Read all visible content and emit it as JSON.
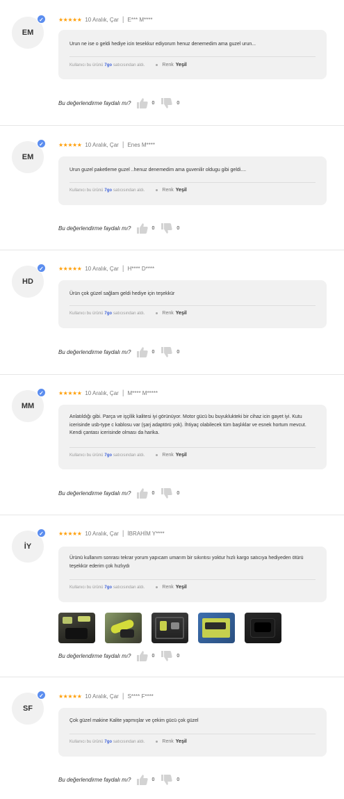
{
  "helpful_question": "Bu değerlendirme faydalı mı?",
  "seller_prefix": "Kullanıcı bu ürünü",
  "seller_suffix": "satıcısından aldı.",
  "color_label": "Renk",
  "colors": {
    "star": "#ff9f0a",
    "verified": "#5b8def",
    "seller_link": "#3b5fd9",
    "bubble": "#f1f1f1"
  },
  "reviews": [
    {
      "initials": "EM",
      "stars": "★★★★★",
      "date": "10 Aralık, Çar",
      "author": "E*** M****",
      "text": "Urun ne ise o geldi hediye icin tesekkur ediyorum henuz denemedim  ama guzel urun...",
      "seller": "7go",
      "color_value": "Yeşil",
      "likes": "0",
      "dislikes": "0"
    },
    {
      "initials": "EM",
      "stars": "★★★★★",
      "date": "10 Aralık, Çar",
      "author": "Enes M****",
      "text": "Urun guzel paketleme guzel ..henuz denemedim ama guvenilir oldugu gibi geldi....",
      "seller": "7go",
      "color_value": "Yeşil",
      "likes": "0",
      "dislikes": "0"
    },
    {
      "initials": "HD",
      "stars": "★★★★★",
      "date": "10 Aralık, Çar",
      "author": "H**** D****",
      "text": "Ürün çok güzel sağlam geldi hediye için teşekkür",
      "seller": "7go",
      "color_value": "Yeşil",
      "likes": "0",
      "dislikes": "0"
    },
    {
      "initials": "MM",
      "stars": "★★★★★",
      "date": "10 Aralık, Çar",
      "author": "M**** M*****",
      "text": "Anlatıldığı gibi. Parça ve işçilik kalitesi iyi görünüyor.  Motor gücü bu buyuklukteki bir cihaz icin gayet iyi. Kutu icerisinde usb-type c kablosu var (şarj adaptörü yok). İhtiyaç olabilecek tüm başlıklar ve esnek hortum mevcut. Kendi çantası icerisinde olması da harika.",
      "seller": "7go",
      "color_value": "Yeşil",
      "likes": "0",
      "dislikes": "0"
    },
    {
      "initials": "İY",
      "stars": "★★★★★",
      "date": "10 Aralık, Çar",
      "author": "İBRAHİM Y****",
      "text": "Ürünü kullanım sonrası tekrar yorum yapıcam umarım bir sıkıntısı yoktur hızlı kargo satıcıya hediyeden ötürü teşekkür ederim çok hızlıydı",
      "seller": "7go",
      "color_value": "Yeşil",
      "likes": "0",
      "dislikes": "0"
    },
    {
      "initials": "SF",
      "stars": "★★★★★",
      "date": "10 Aralık, Çar",
      "author": "S**** F****",
      "text": "Çok güzel makine Kalite yapmışlar  ve çekim gücü çok güzel",
      "seller": "7go",
      "color_value": "Yeşil",
      "likes": "0",
      "dislikes": "0"
    }
  ]
}
